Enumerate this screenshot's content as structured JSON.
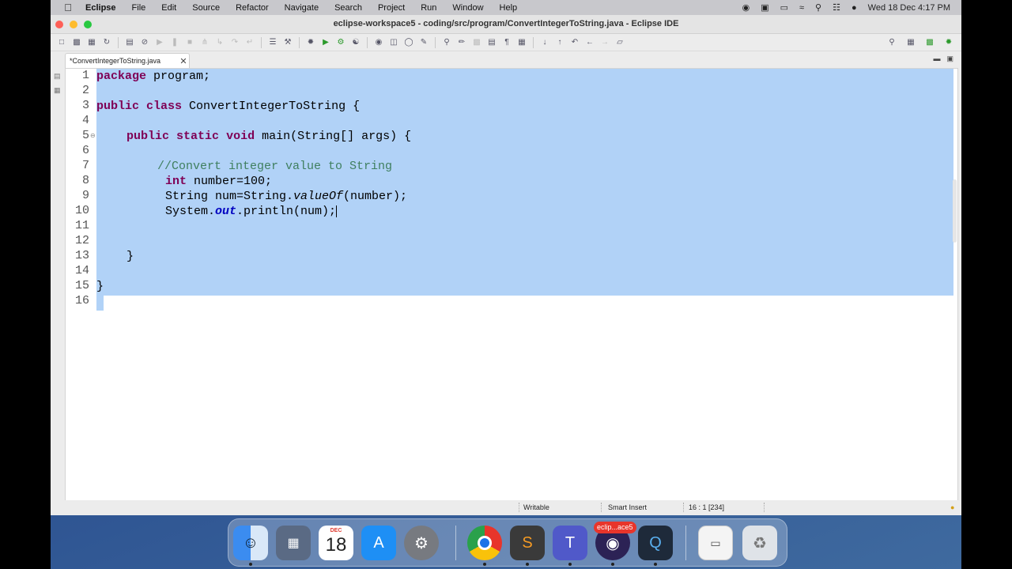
{
  "menubar": {
    "app_name": "Eclipse",
    "items": [
      "File",
      "Edit",
      "Source",
      "Refactor",
      "Navigate",
      "Search",
      "Project",
      "Run",
      "Window",
      "Help"
    ],
    "clock": "Wed 18 Dec  4:17 PM"
  },
  "window": {
    "title": "eclipse-workspace5 - coding/src/program/ConvertIntegerToString.java - Eclipse IDE"
  },
  "editor": {
    "tab_label": "*ConvertIntegerToString.java",
    "line_numbers": [
      "1",
      "2",
      "3",
      "4",
      "5",
      "6",
      "7",
      "8",
      "9",
      "10",
      "11",
      "12",
      "13",
      "14",
      "15",
      "16"
    ],
    "code": {
      "l1_kw": "package",
      "l1_rest": " program;",
      "l3_kw1": "public",
      "l3_kw2": "class",
      "l3_rest": " ConvertIntegerToString {",
      "l5_kw1": "public",
      "l5_kw2": "static",
      "l5_kw3": "void",
      "l5_rest": " main(String[] args) {",
      "l7_comment": "//Convert integer value to String",
      "l8_kw": "int",
      "l8_rest": " number=100;",
      "l9_a": "String num=String.",
      "l9_method": "valueOf",
      "l9_b": "(number);",
      "l10_a": "System.",
      "l10_field": "out",
      "l10_b": ".println(num);",
      "l13": "}",
      "l15": "}"
    }
  },
  "statusbar": {
    "writable": "Writable",
    "insert_mode": "Smart Insert",
    "position": "16 : 1 [234]"
  },
  "dock": {
    "calendar_month": "DEC",
    "calendar_day": "18",
    "eclipse_badge": "eclip...ace5"
  }
}
